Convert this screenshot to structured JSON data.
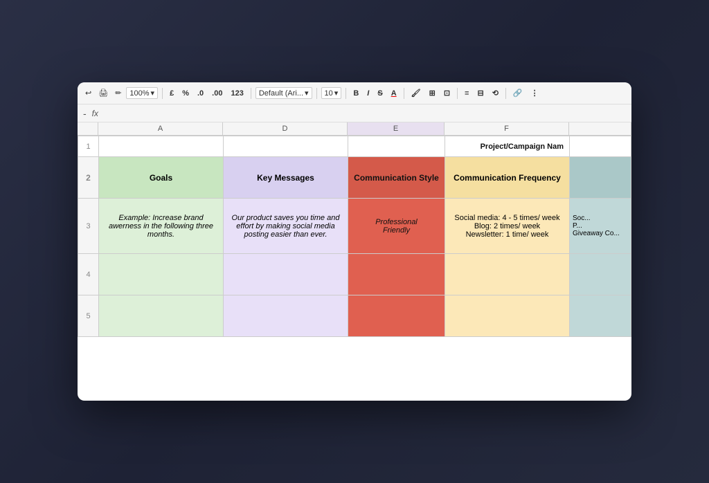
{
  "toolbar": {
    "zoom": "100%",
    "currency": "£",
    "percent": "%",
    "decimal1": ".0",
    "decimal2": ".00",
    "number_format": "123",
    "font_family": "Default (Ari...",
    "font_size": "10",
    "bold": "B",
    "italic": "I",
    "strikethrough": "S",
    "font_color": "A",
    "undo_label": "↩",
    "redo_label": "↪"
  },
  "formula_bar": {
    "minus": "-",
    "fx": "fx"
  },
  "columns": {
    "headers": [
      "A",
      "D",
      "E",
      "F",
      ""
    ]
  },
  "title_row": {
    "label": "Project/Campaign Nam"
  },
  "header_row": {
    "goals": "Goals",
    "key_messages": "Key Messages",
    "communication_style": "Communication Style",
    "communication_frequency": "Communication Frequency"
  },
  "data_row_1": {
    "goals": "Example: Increase brand awerness in the following three months.",
    "key_messages": "Our product saves you time and effort by making social media posting easier than ever.",
    "communication_style": "Professional\nFriendly",
    "communication_frequency": "Social media: 4 - 5 times/ week\nBlog: 2 times/ week\nNewsletter: 1 time/ week",
    "extra_partial": "Soc...\nP...\nGiveaway Co..."
  }
}
